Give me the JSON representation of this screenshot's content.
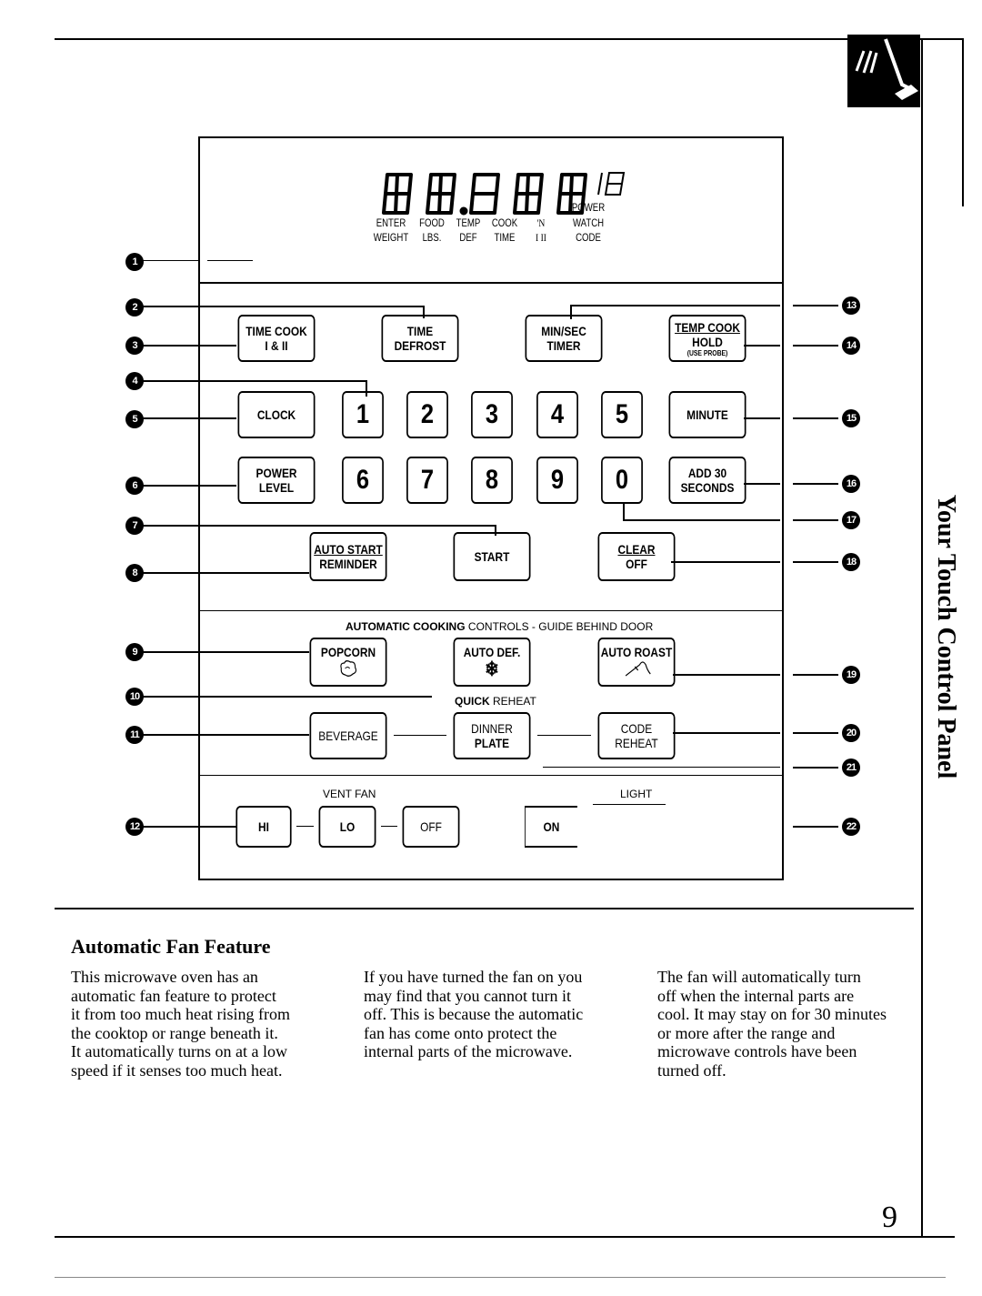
{
  "page": {
    "section_tab_title": "Your Touch Control Panel",
    "page_number": "9"
  },
  "display": {
    "digits": [
      "8",
      "8",
      "8",
      "8",
      "8"
    ],
    "power_level_digits": "18",
    "labels": [
      {
        "line1": "ENTER",
        "line2": "WEIGHT"
      },
      {
        "line1": "FOOD",
        "line2": "LBS."
      },
      {
        "line1": "TEMP",
        "line2": "DEF"
      },
      {
        "line1": "COOK",
        "line2": "TIME"
      },
      {
        "line1": "'N",
        "line2": "I  II"
      },
      {
        "line1": "POWER",
        "line2": "WATCH",
        "line3": "CODE"
      }
    ]
  },
  "buttons": {
    "time_cook": {
      "line1": "TIME COOK",
      "line2": "I & II"
    },
    "time_defrost": {
      "line1": "TIME",
      "line2": "DEFROST"
    },
    "min_sec_timer": {
      "line1": "MIN/SEC",
      "line2": "TIMER"
    },
    "temp_cook": {
      "line1": "TEMP COOK",
      "line2": "HOLD",
      "line3": "(USE PROBE)"
    },
    "clock": "CLOCK",
    "power_level": {
      "line1": "POWER",
      "line2": "LEVEL"
    },
    "digits_row1": [
      "1",
      "2",
      "3",
      "4",
      "5"
    ],
    "digits_row2": [
      "6",
      "7",
      "8",
      "9",
      "0"
    ],
    "minute": "MINUTE",
    "add_30": {
      "line1": "ADD 30",
      "line2": "SECONDS"
    },
    "auto_start": {
      "line1": "AUTO START",
      "line2": "REMINDER"
    },
    "start": "START",
    "clear_off": {
      "line1": "CLEAR",
      "line2": "OFF"
    },
    "popcorn": "POPCORN",
    "auto_def": "AUTO DEF.",
    "auto_roast": "AUTO ROAST",
    "beverage": "BEVERAGE",
    "dinner_plate": {
      "line1": "DINNER",
      "line2": "PLATE"
    },
    "code_reheat": {
      "line1": "CODE",
      "line2": "REHEAT"
    },
    "fan_hi": "HI",
    "fan_lo": "LO",
    "fan_off": "OFF",
    "light_on": "ON"
  },
  "section_labels": {
    "auto_cooking_bold": "AUTOMATIC COOKING",
    "auto_cooking_rest": " CONTROLS - GUIDE BEHIND DOOR",
    "quick_bold": "QUICK",
    "quick_rest": " REHEAT",
    "vent_fan": "VENT FAN",
    "light": "LIGHT"
  },
  "callouts": [
    "1",
    "2",
    "3",
    "4",
    "5",
    "6",
    "7",
    "8",
    "9",
    "10",
    "11",
    "12",
    "13",
    "14",
    "15",
    "16",
    "17",
    "18",
    "19",
    "20",
    "21",
    "22"
  ],
  "article": {
    "heading": "Automatic Fan Feature",
    "col1": "This microwave oven has an\nautomatic fan feature to protect\nit from too much heat rising from\nthe cooktop or range beneath it.\nIt automatically turns on at a low\nspeed if it senses too much heat.",
    "col2": "If you have turned the fan on you\nmay find that you cannot turn it\noff. This is because the automatic\nfan has come onto protect the\ninternal parts of the microwave.",
    "col3": "The fan will automatically turn\noff when the internal parts are\ncool. It may stay on for 30 minutes\nor more after the range and\nmicrowave controls have been\nturned off."
  }
}
